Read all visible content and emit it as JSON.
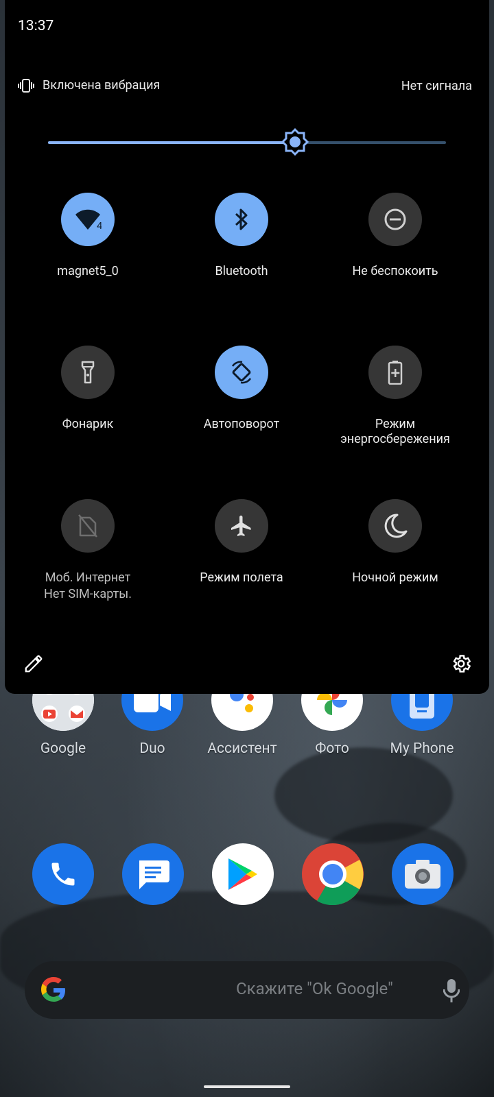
{
  "status_bar": {
    "time": "13:37"
  },
  "quick_settings": {
    "header": {
      "ringer_mode": "Включена вибрация",
      "signal_status": "Нет сигнала"
    },
    "brightness": {
      "level_percent": 62
    },
    "tiles": [
      {
        "id": "wifi",
        "label": "magnet5_0",
        "badge": "4",
        "icon": "wifi-icon",
        "active": true
      },
      {
        "id": "bluetooth",
        "label": "Bluetooth",
        "icon": "bluetooth-icon",
        "active": true
      },
      {
        "id": "dnd",
        "label": "Не беспокоить",
        "icon": "do-not-disturb-icon",
        "active": false
      },
      {
        "id": "flashlight",
        "label": "Фонарик",
        "icon": "flashlight-icon",
        "active": false
      },
      {
        "id": "autorotate",
        "label": "Автоповорот",
        "icon": "auto-rotate-icon",
        "active": true
      },
      {
        "id": "battery_saver",
        "label": "Режим энергосбережения",
        "icon": "battery-saver-icon",
        "active": false
      },
      {
        "id": "mobile_data",
        "label": "Моб. Интернет",
        "sub": "Нет SIM-карты.",
        "icon": "no-sim-icon",
        "active": false,
        "disabled": true
      },
      {
        "id": "airplane",
        "label": "Режим полета",
        "icon": "airplane-icon",
        "active": false
      },
      {
        "id": "night_mode",
        "label": "Ночной режим",
        "icon": "moon-icon",
        "active": false
      }
    ],
    "footer": {
      "edit_icon": "pencil-icon",
      "settings_icon": "gear-icon"
    }
  },
  "home": {
    "apps_row": [
      "Google",
      "Duo",
      "Ассистент",
      "Фото",
      "My Phone"
    ],
    "dock": [
      "phone-icon",
      "messages-icon",
      "play-store-icon",
      "chrome-icon",
      "camera-icon"
    ],
    "search": {
      "placeholder": "Скажите \"Ok Google\""
    }
  },
  "colors": {
    "accent": "#75aef6",
    "tile_off": "#363636",
    "panel_bg": "#000000"
  }
}
